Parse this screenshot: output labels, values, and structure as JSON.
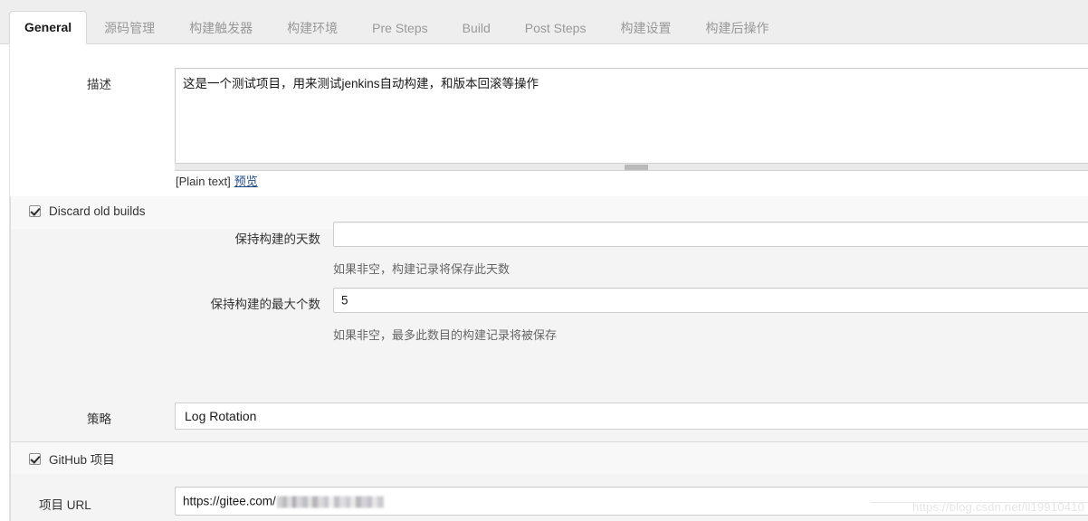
{
  "tabs": [
    {
      "label": "General",
      "active": true
    },
    {
      "label": "源码管理",
      "active": false
    },
    {
      "label": "构建触发器",
      "active": false
    },
    {
      "label": "构建环境",
      "active": false
    },
    {
      "label": "Pre Steps",
      "active": false
    },
    {
      "label": "Build",
      "active": false
    },
    {
      "label": "Post Steps",
      "active": false
    },
    {
      "label": "构建设置",
      "active": false
    },
    {
      "label": "构建后操作",
      "active": false
    }
  ],
  "description": {
    "label": "描述",
    "value": "这是一个测试项目，用来测试jenkins自动构建，和版本回滚等操作",
    "markup_label": "[Plain text]",
    "preview_link": "预览"
  },
  "discard_old_builds": {
    "checkbox_label": "Discard old builds",
    "checked": true,
    "strategy": {
      "label": "策略",
      "value": "Log Rotation"
    },
    "days_to_keep": {
      "label": "保持构建的天数",
      "value": "",
      "hint": "如果非空，构建记录将保存此天数"
    },
    "max_builds_to_keep": {
      "label": "保持构建的最大个数",
      "value": "5",
      "hint": "如果非空，最多此数目的构建记录将被保存"
    }
  },
  "github_project": {
    "checkbox_label": "GitHub 项目",
    "checked": true,
    "project_url": {
      "label": "项目 URL",
      "value": "https://gitee.com/",
      "redacted": true
    }
  },
  "watermark": {
    "text": "https://blog.csdn.net/ll19910410"
  },
  "colors": {
    "tabbar_bg": "#eeeeee",
    "active_tab_bg": "#ffffff",
    "tab_inactive_text": "#999999",
    "band_grey": "#f4f4f4",
    "band_light": "#f8f8f8",
    "link": "#204a87",
    "border": "#cccccc"
  }
}
